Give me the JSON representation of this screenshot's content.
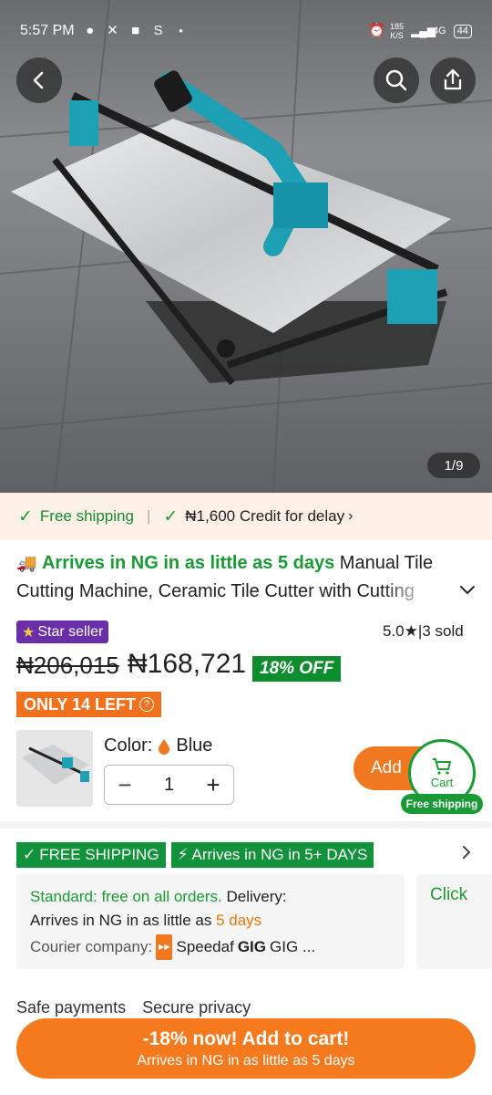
{
  "status_bar": {
    "time": "5:57 PM",
    "speed": "185",
    "speed_unit": "K/S",
    "network": "4G",
    "battery": "44"
  },
  "gallery": {
    "counter": "1/9",
    "icons": [
      "back-arrow-icon",
      "search-icon",
      "share-icon"
    ]
  },
  "ship_strip": {
    "free_shipping": "Free shipping",
    "credit": "₦1,600 Credit for delay"
  },
  "product": {
    "arrive_text": "Arrives in NG in as little as 5 days",
    "title": "Manual Tile Cutting Machine, Ceramic Tile Cutter with Cutting"
  },
  "seller": {
    "badge": "Star seller",
    "rating": "5.0",
    "sold": "3 sold"
  },
  "price": {
    "old": "₦206,015",
    "current": "₦168,721",
    "discount": "18% OFF",
    "stock": "ONLY 14 LEFT"
  },
  "variant": {
    "color_label": "Color:",
    "color_value": "Blue",
    "quantity": "1",
    "add_label": "Add",
    "cart_label": "Cart",
    "free_shipping_pill": "Free shipping"
  },
  "shipping": {
    "badge_free": "FREE SHIPPING",
    "badge_arrive": "Arrives in NG in 5+ DAYS",
    "standard": "Standard: free on all orders.",
    "delivery_label": "Delivery:",
    "delivery_text": "Arrives in NG in as little as",
    "delivery_days": "5 days",
    "courier_label": "Courier company:",
    "courier_1": "Speedaf",
    "courier_2": "GIG ...",
    "courier_2_logo": "GIG",
    "click_card": "Click"
  },
  "safe": {
    "payments": "Safe payments",
    "privacy": "Secure privacy"
  },
  "cta": {
    "main": "-18% now! Add to cart!",
    "sub": "Arrives in NG in as little as 5 days"
  },
  "colors": {
    "brand_orange": "#f57a1e",
    "green": "#1a9a34",
    "star_seller_purple": "#6a2fa8"
  }
}
